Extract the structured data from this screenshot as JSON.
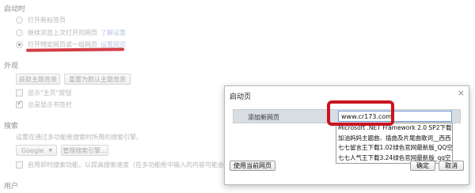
{
  "settings": {
    "startup": {
      "title": "启动时",
      "options": [
        {
          "label": "打开新标签页"
        },
        {
          "label": "继续浏览上次打开的网页",
          "link": "了解设置"
        },
        {
          "label": "打开特定网页或一组网页",
          "link": "设置网页"
        }
      ]
    },
    "appearance": {
      "title": "外观",
      "get_themes": "获取主题背景",
      "reset_theme": "重置为默认主题背景",
      "show_home": "显示\"主页\"按钮",
      "show_bookmarks": "总是显示书签栏"
    },
    "search": {
      "title": "搜索",
      "description": "设置在通过多功能框搜索时所用的搜索引擎。",
      "description_link": "多功能框",
      "engine": "Google",
      "manage_engines": "管理搜索引擎...",
      "instant": "启用即时搜索功能，以提高搜索速度（在多功能框中输入的内容可能会",
      "instant_link": "记"
    },
    "users": {
      "title": "用户"
    }
  },
  "dialog": {
    "title": "启动页",
    "close": "×",
    "add_page_label": "添加新网页",
    "url_value": "www.cr173.com",
    "suggestions": [
      "Microsoft .NET Framework 2.0 SP2下载|官",
      "加油妈妈主题曲、插曲及片尾曲歌词__西西",
      "七七留言王下载1.02绿色官网最新版_QQ空",
      "七七人气王下载3.24绿色官网最新版_qq空"
    ],
    "use_current": "使用当前网页",
    "ok": "确定",
    "cancel": "取消"
  },
  "colors": {
    "annotation_red": "#c9141f",
    "link": "#a9b9e0"
  }
}
